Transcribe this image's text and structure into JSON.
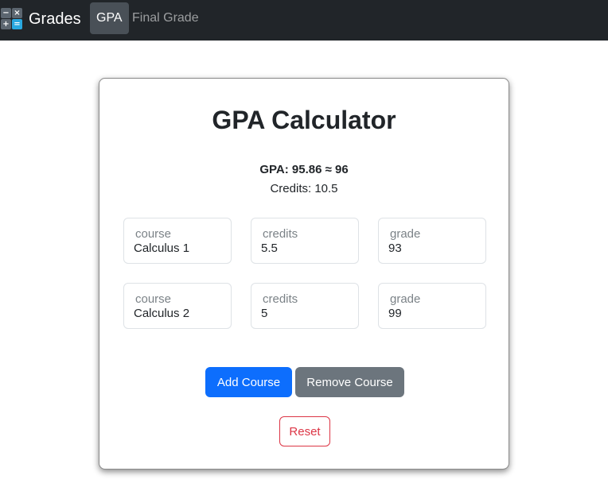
{
  "navbar": {
    "brand_icon": "calculator-icon",
    "brand_icon_glyphs": [
      "−",
      "×",
      "+",
      "="
    ],
    "brand_text": "Grades",
    "items": [
      {
        "label": "GPA",
        "active": true
      },
      {
        "label": "Final Grade",
        "active": false
      }
    ]
  },
  "card": {
    "title": "GPA Calculator",
    "gpa_text": "GPA: 95.86 ≈ 96",
    "credits_text": "Credits: 10.5",
    "courses": [
      {
        "course_label": "course",
        "course_value": "Calculus 1",
        "credits_label": "credits",
        "credits_value": "5.5",
        "grade_label": "grade",
        "grade_value": "93"
      },
      {
        "course_label": "course",
        "course_value": "Calculus 2",
        "credits_label": "credits",
        "credits_value": "5",
        "grade_label": "grade",
        "grade_value": "99"
      }
    ],
    "add_course_label": "Add Course",
    "remove_course_label": "Remove Course",
    "reset_label": "Reset"
  },
  "colors": {
    "navbar_bg": "#212529",
    "primary": "#0d6efd",
    "secondary": "#6c757d",
    "danger": "#dc3545"
  }
}
